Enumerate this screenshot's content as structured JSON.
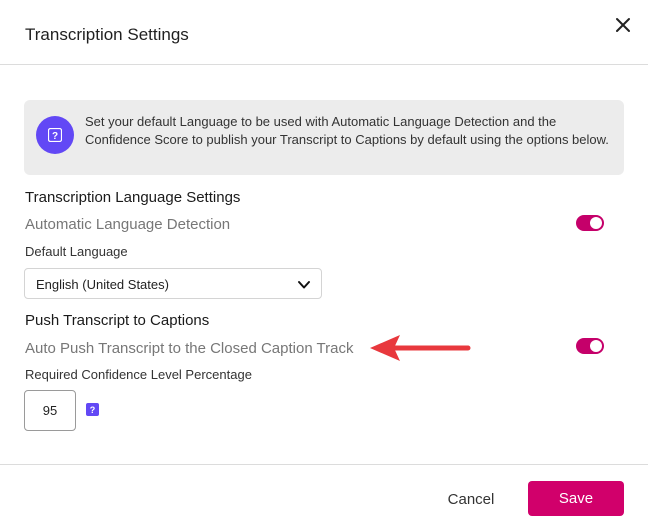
{
  "dialog": {
    "title": "Transcription Settings",
    "close_icon": "close-icon"
  },
  "info": {
    "icon": "help-icon",
    "text": "Set your default Language to be used with Automatic Language Detection and the Confidence Score to publish your Transcript to Captions by default using the options below."
  },
  "language_settings": {
    "section_title": "Transcription Language Settings",
    "auto_detect_label": "Automatic Language Detection",
    "auto_detect_enabled": true,
    "default_language_label": "Default Language",
    "default_language_value": "English (United States)"
  },
  "captions": {
    "section_title": "Push Transcript to Captions",
    "auto_push_label": "Auto Push Transcript to the Closed Caption Track",
    "auto_push_enabled": true,
    "confidence_label": "Required Confidence Level Percentage",
    "confidence_value": "95"
  },
  "annotation": {
    "arrow_icon": "arrow-left-icon",
    "color": "#e8383d"
  },
  "footer": {
    "cancel_label": "Cancel",
    "save_label": "Save"
  },
  "colors": {
    "accent": "#d1006b",
    "info_icon": "#6248f5",
    "info_background": "#ececec"
  }
}
